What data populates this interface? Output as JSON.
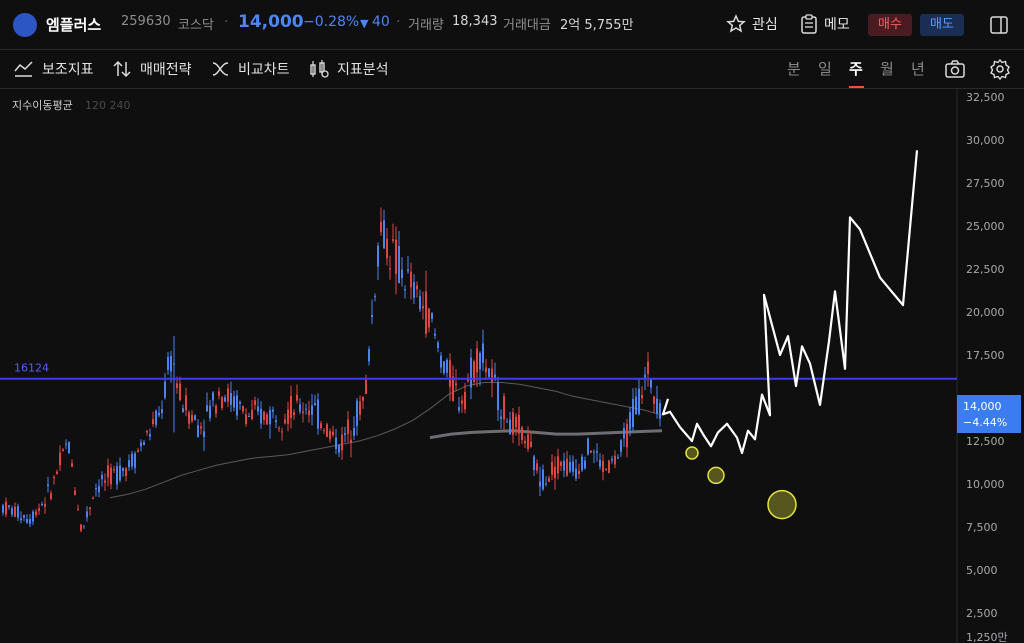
{
  "header": {
    "stock_name": "엠플러스",
    "stock_code": "259630",
    "market": "코스닥",
    "price": "14,000",
    "change_pct": "−0.28%",
    "change_abs": "40",
    "volume_label": "거래량",
    "volume": "18,343",
    "amount_label": "거래대금",
    "amount": "2억 5,755만",
    "watch_label": "관심",
    "memo_label": "메모",
    "buy_label": "매수",
    "sell_label": "매도"
  },
  "toolbar": {
    "indicators_label": "보조지표",
    "strategy_label": "매매전략",
    "compare_label": "비교차트",
    "analysis_label": "지표분석",
    "periods": [
      "분",
      "일",
      "주",
      "월",
      "년"
    ],
    "active_period": "주"
  },
  "colors": {
    "up": "#e0453f",
    "down": "#4a84f0",
    "hline": "#3b3bf0",
    "accent": "#ff4d2e"
  },
  "chart_data": {
    "type": "candlestick",
    "legend_title": "지수이동평균",
    "legend_params": "120 240",
    "y_ticks": [
      "32,500",
      "30,000",
      "27,500",
      "25,000",
      "22,500",
      "20,000",
      "17,500",
      "14,000",
      "12,500",
      "10,000",
      "7,500",
      "5,000",
      "2,500",
      "1,250만"
    ],
    "ylim": [
      1250,
      32500
    ],
    "hline": {
      "label": "16124",
      "value": 16124
    },
    "last_price_label": "14,000",
    "last_change_label": "−4.44%",
    "ma_120": [
      9200,
      9400,
      9700,
      10100,
      10500,
      10800,
      11100,
      11300,
      11500,
      11600,
      11700,
      11900,
      12100,
      12300,
      12500,
      12800,
      13200,
      13700,
      14400,
      15200,
      15700,
      15900,
      15900,
      15800,
      15600,
      15400,
      15100,
      14900,
      14700,
      14500,
      14300,
      14000
    ],
    "ma_240": [
      12700,
      12900,
      13000,
      13050,
      13100,
      13000,
      12900,
      12900,
      12950,
      13000,
      13050,
      13100
    ],
    "projection": [
      [
        14950,
        14050,
        14200,
        13300,
        12900,
        12500,
        13500,
        12800,
        12200,
        13000,
        13500,
        12700,
        11800,
        13100,
        12600,
        15200,
        14000,
        21000,
        17500,
        18600,
        15700,
        18000,
        17000,
        14600,
        18300,
        21200,
        16700,
        25500,
        24800,
        22000,
        20400,
        29400
      ]
    ],
    "highlight_circles": [
      11800,
      10500,
      8800
    ]
  }
}
